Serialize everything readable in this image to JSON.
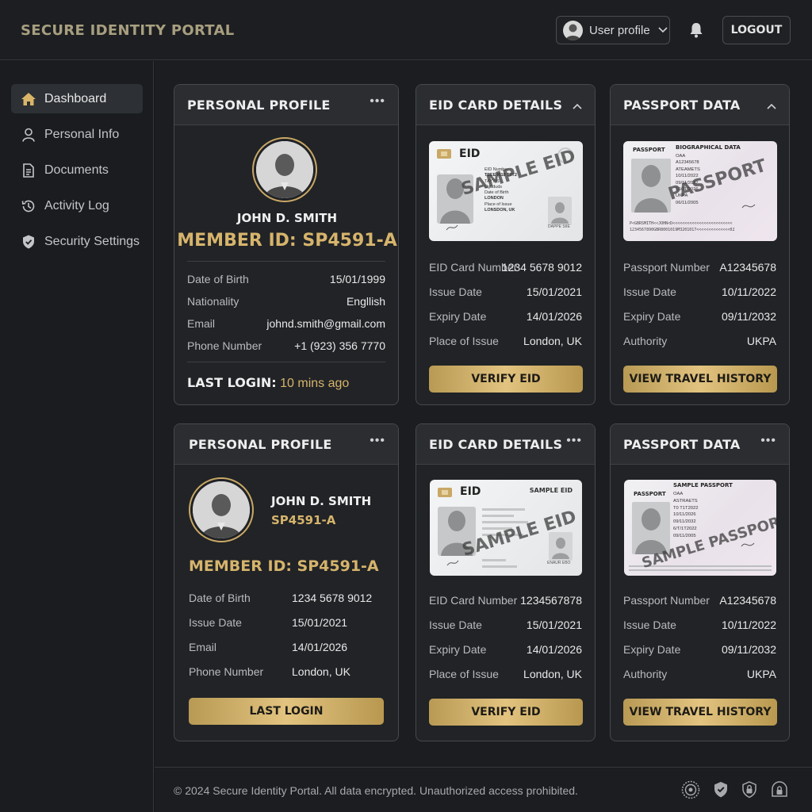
{
  "app": {
    "title": "SECURE IDENTITY PORTAL"
  },
  "header": {
    "profile_label": "User profile",
    "logout_label": "LOGOUT"
  },
  "sidebar": {
    "items": [
      {
        "label": "Dashboard",
        "icon": "home-icon",
        "active": true
      },
      {
        "label": "Personal Info",
        "icon": "user-icon"
      },
      {
        "label": "Documents",
        "icon": "document-icon"
      },
      {
        "label": "Activity Log",
        "icon": "history-icon"
      },
      {
        "label": "Security Settings",
        "icon": "shield-icon"
      }
    ]
  },
  "profile1": {
    "title": "PERSONAL PROFILE",
    "menu": "•••",
    "name": "JOHN D. SMITH",
    "member_id": "MEMBER ID: SP4591-A",
    "rows": [
      {
        "label": "Date of Birth",
        "value": "15/01/1999"
      },
      {
        "label": "Nationality",
        "value": "Engllish"
      },
      {
        "label": "Email",
        "value": "johnd.smith@gmail.com"
      },
      {
        "label": "Phone Number",
        "value": "+1 (923) 356 7770"
      }
    ],
    "last_login_label": "LAST LOGIN:",
    "last_login_value": "10 mins ago"
  },
  "eid1": {
    "title": "EID CARD DETAILS",
    "toggle": "⌃",
    "card_label": "EID",
    "watermark": "SAMPLE EID",
    "card_lines": [
      "EID Number",
      "TEEE M18 T0T2",
      "TAYYIS",
      "Ugaduds",
      "Date of Birth",
      "LONDON",
      "Place of Issue",
      "LONSDON, UK",
      "DAPPE SIIE"
    ],
    "rows": [
      {
        "label": "EID Card Number",
        "value": "1234 5678 9012"
      },
      {
        "label": "Issue Date",
        "value": "15/01/2021"
      },
      {
        "label": "Expiry Date",
        "value": "14/01/2026"
      },
      {
        "label": "Place of Issue",
        "value": "London, UK"
      }
    ],
    "button": "VERIFY EID"
  },
  "passport1": {
    "title": "PASSPORT DATA",
    "toggle": "⌃",
    "card_label": "PASSPORT",
    "card_header": "BIOGRAPHICAL DATA",
    "watermark": "PASSPORT",
    "card_lines": [
      "OAA",
      "A12345678",
      "ATEAMETS",
      "10/11/2022",
      "09/11/2032",
      "10/11/2026",
      "UKPA",
      "06/11/2005",
      "08/11/2005",
      "09/11/2005"
    ],
    "mrz": [
      "P<GBRSMITH<<JOHN<D<<<<<<<<<<<<<<<<<<<<<<<<<",
      "1234567890GBR8001019M3201017<<<<<<<<<<<<<<02"
    ],
    "rows": [
      {
        "label": "Passport Number",
        "value": "A12345678"
      },
      {
        "label": "Issue Date",
        "value": "10/11/2022"
      },
      {
        "label": "Expiry Date",
        "value": "09/11/2032"
      },
      {
        "label": "Authority",
        "value": "UKPA"
      }
    ],
    "button": "VIEW TRAVEL HISTORY"
  },
  "profile2": {
    "title": "PERSONAL PROFILE",
    "menu": "•••",
    "name": "JOHN D. SMITH",
    "sub_id": "SP4591-A",
    "member_id": "MEMBER ID: SP4591-A",
    "rows": [
      {
        "label": "Date of Birth",
        "value": "1234 5678 9012"
      },
      {
        "label": "Issue Date",
        "value": "15/01/2021"
      },
      {
        "label": "Email",
        "value": "14/01/2026"
      },
      {
        "label": "Phone Number",
        "value": "London, UK"
      }
    ],
    "button": "LAST LOGIN"
  },
  "eid2": {
    "title": "EID CARD DETAILS",
    "menu": "•••",
    "card_label": "EID",
    "card_tag": "SAMPLE EID",
    "watermark": "SAMPLE EID",
    "card_lines": [
      "ENAUR EBO"
    ],
    "rows": [
      {
        "label": "EID Card Number",
        "value": "1234567878"
      },
      {
        "label": "Issue Date",
        "value": "15/01/2021"
      },
      {
        "label": "Expiry Date",
        "value": "14/01/2026"
      },
      {
        "label": "Place of Issue",
        "value": "London, UK"
      }
    ],
    "button": "VERIFY EID"
  },
  "passport2": {
    "title": "PASSPORT DATA",
    "menu": "•••",
    "card_label": "PASSPORT",
    "card_header": "SAMPLE PASSPORT",
    "watermark": "SAMPLE PASSPORT",
    "card_lines": [
      "OAA",
      "ASTRAETS",
      "T0 T1T2022",
      "10/11/2026",
      "09/11/2032",
      "6/T/1T2022",
      "09/11/2005"
    ],
    "rows": [
      {
        "label": "Passport Number",
        "value": "A12345678"
      },
      {
        "label": "Issue Date",
        "value": "10/11/2022"
      },
      {
        "label": "Expiry Date",
        "value": "09/11/2032"
      },
      {
        "label": "Authority",
        "value": "UKPA"
      }
    ],
    "button": "VIEW TRAVEL HISTORY"
  },
  "footer": {
    "text": "© 2024 Secure Identity Portal. All data encrypted. Unauthorized access prohibited.",
    "icons": [
      "seal-icon",
      "shield-check-icon",
      "lock-icon",
      "secure-badge-icon"
    ]
  },
  "colors": {
    "accent_gold": "#d6b46c",
    "background": "#16181b",
    "card": "#212326"
  }
}
